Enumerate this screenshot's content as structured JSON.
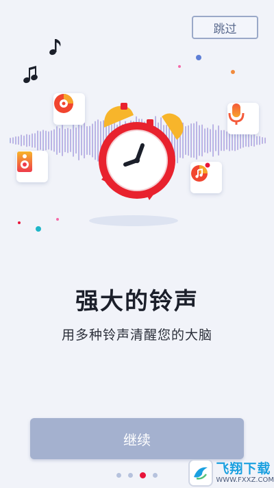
{
  "header": {
    "skip_label": "跳过"
  },
  "hero": {
    "icons": [
      "music-note-icon",
      "music-note-icon",
      "speaker-icon",
      "music-disc-icon",
      "alarm-clock-icon",
      "microphone-icon",
      "music-bomb-icon"
    ],
    "colors": {
      "clock_red": "#e8222e",
      "bell_yellow": "#f7b52b",
      "wave_pink": "#f56aa8",
      "wave_blue": "#5fc4ee"
    }
  },
  "content": {
    "title": "强大的铃声",
    "subtitle": "用多种铃声清醒您的大脑"
  },
  "footer": {
    "continue_label": "继续",
    "page_indicator": {
      "total": 4,
      "current": 3
    }
  },
  "watermark": {
    "main": "飞翔下载",
    "sub": "WWW.FXXZ.COM"
  },
  "colors": {
    "accent": "#e8153a",
    "button_bg": "#a4b1cf",
    "background": "#f1f3f9"
  }
}
